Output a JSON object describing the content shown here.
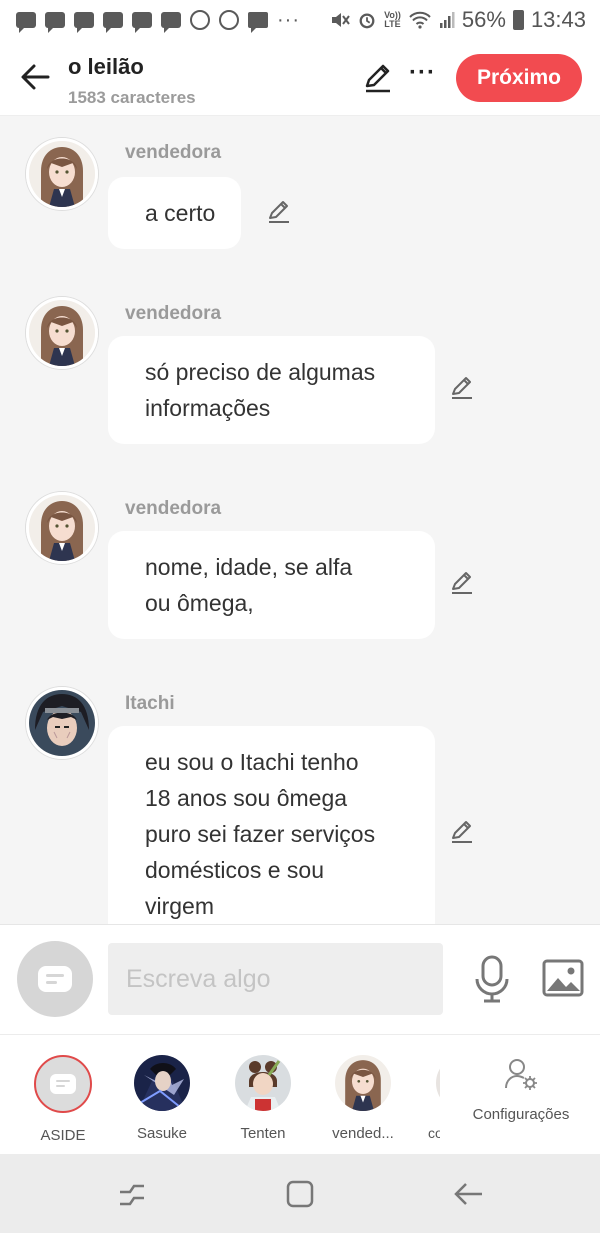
{
  "status_bar": {
    "battery": "56%",
    "time": "13:43"
  },
  "header": {
    "title": "o leilão",
    "subtitle": "1583 caracteres",
    "next_label": "Próximo"
  },
  "messages": [
    {
      "sender": "vendedora",
      "lines": [
        "a certo"
      ],
      "avatar": "vendedora"
    },
    {
      "sender": "vendedora",
      "lines": [
        "só preciso de algumas",
        "informações"
      ],
      "avatar": "vendedora"
    },
    {
      "sender": "vendedora",
      "lines": [
        "nome, idade, se alfa",
        "ou ômega,"
      ],
      "avatar": "vendedora"
    },
    {
      "sender": "Itachi",
      "lines": [
        "eu sou o Itachi tenho",
        "18 anos sou ômega",
        "puro sei fazer serviços",
        "domésticos e sou",
        "virgem"
      ],
      "avatar": "itachi"
    }
  ],
  "composer": {
    "placeholder": "Escreva algo"
  },
  "tray": {
    "characters": [
      {
        "name": "ASIDE"
      },
      {
        "name": "Sasuke"
      },
      {
        "name": "Tenten"
      },
      {
        "name": "vended..."
      },
      {
        "name": "co"
      }
    ],
    "settings_label": "Configurações"
  },
  "colors": {
    "accent": "#f24b50",
    "background": "#f5f5f5"
  }
}
